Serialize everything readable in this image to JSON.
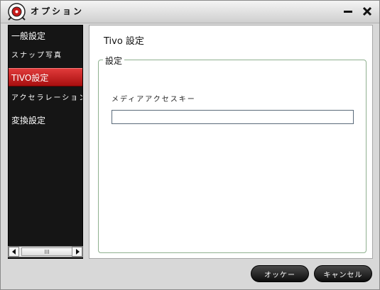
{
  "window": {
    "title": "オプション",
    "logo_icon": "app-logo-icon",
    "minimize_icon": "minimize-icon",
    "close_icon": "close-icon"
  },
  "sidebar": {
    "items": [
      {
        "label": "一般設定",
        "active": false
      },
      {
        "label": "スナップ写真",
        "active": false
      },
      {
        "label": "TIVO設定",
        "active": true
      },
      {
        "label": "アクセラレーション",
        "active": false
      },
      {
        "label": "変換設定",
        "active": false
      }
    ],
    "scrollbar": {
      "left_icon": "arrow-left-icon",
      "right_icon": "arrow-right-icon",
      "grip": "III"
    }
  },
  "content": {
    "title": "Tivo 設定",
    "group_label": "設定",
    "field_label": "メディアアクセスキー",
    "field_value": "",
    "field_placeholder": ""
  },
  "footer": {
    "ok_label": "オッケー",
    "cancel_label": "キャンセル"
  },
  "colors": {
    "accent": "#c61a1a",
    "sidebar_bg": "#151515",
    "group_border": "#8fb08f"
  }
}
